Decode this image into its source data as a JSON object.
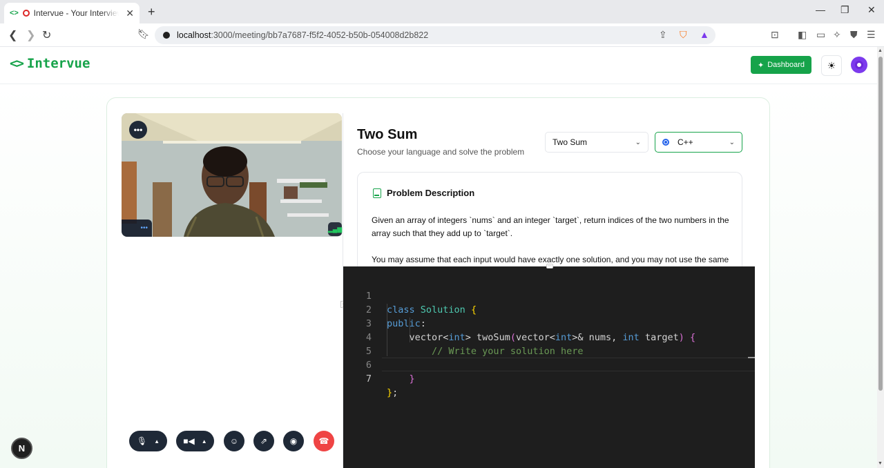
{
  "browser": {
    "tab_title": "Intervue - Your Interview Platform",
    "url_host": "localhost",
    "url_path": ":3000/meeting/bb7a7687-f5f2-4052-b50b-054008d2b822"
  },
  "header": {
    "logo_text": "Intervue",
    "dashboard_label": "Dashboard"
  },
  "video": {
    "participant_tag": "•••"
  },
  "problem": {
    "title": "Two Sum",
    "subtitle": "Choose your language and solve the problem",
    "problem_select_value": "Two Sum",
    "language_select_value": "C++",
    "description_heading": "Problem Description",
    "description_p1": "Given an array of integers `nums` and an integer `target`, return indices of the two numbers in the array such that they add up to `target`.",
    "description_p2": "You may assume that each input would have exactly one solution, and you may not use the same"
  },
  "editor": {
    "line_numbers": [
      "1",
      "2",
      "3",
      "4",
      "5",
      "6",
      "7"
    ],
    "active_line": 7
  },
  "colors": {
    "brand": "#16a34a",
    "end_call": "#ef4444",
    "editor_bg": "#1e1e1e"
  },
  "nextjs_badge": "N"
}
